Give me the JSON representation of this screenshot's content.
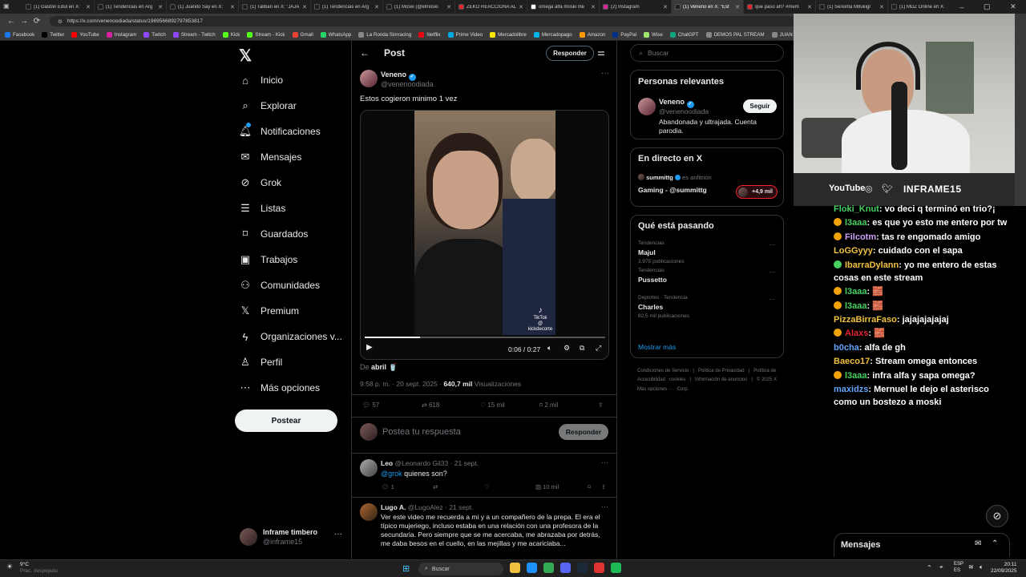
{
  "browser": {
    "tabs": [
      {
        "label": "(1) Gastón Edul en X:",
        "color": "#1d1d1d"
      },
      {
        "label": "(1) Tendencias en Arg",
        "color": "#1d1d1d"
      },
      {
        "label": "(1) Juanito Say en X:",
        "color": "#1d1d1d"
      },
      {
        "label": "(1) Taliban en X: \"JAJA",
        "color": "#1d1d1d"
      },
      {
        "label": "(1) Tendencias en Arg",
        "color": "#1d1d1d"
      },
      {
        "label": "(1) Moski (@elmoski",
        "color": "#1d1d1d"
      },
      {
        "label": "ZEKO REACCIONA AL",
        "color": "#e0252f"
      },
      {
        "label": "omega alfa moski me",
        "color": "#ffffff"
      },
      {
        "label": "(2) Instagram",
        "color": "#d6249f"
      },
      {
        "label": "(1) Veneno en X: \"Est",
        "color": "#1d1d1d",
        "active": true
      },
      {
        "label": "que paso ah? #mem",
        "color": "#e0252f"
      },
      {
        "label": "(1) Señorita M8ukigr",
        "color": "#1d1d1d"
      },
      {
        "label": "(1) MDZ Online en X:",
        "color": "#1d1d1d"
      }
    ],
    "new_tab": "+",
    "url": "https://x.com/venenoodiada/status/1969566892797853817",
    "bookmarks": [
      {
        "label": "Facebook",
        "color": "#1877f2"
      },
      {
        "label": "Twitter",
        "color": "#000000"
      },
      {
        "label": "YouTube",
        "color": "#ff0000"
      },
      {
        "label": "Instagram",
        "color": "#d6249f"
      },
      {
        "label": "Twitch",
        "color": "#9146ff"
      },
      {
        "label": "Stream - Twitch",
        "color": "#9146ff"
      },
      {
        "label": "Kick",
        "color": "#53fc18"
      },
      {
        "label": "Stream - Kick",
        "color": "#53fc18"
      },
      {
        "label": "Gmail",
        "color": "#ea4335"
      },
      {
        "label": "WhatsApp",
        "color": "#25d366"
      },
      {
        "label": "La Ronda Simracing",
        "color": "#888888"
      },
      {
        "label": "Netflix",
        "color": "#e50914"
      },
      {
        "label": "Prime Video",
        "color": "#00a8e1"
      },
      {
        "label": "Mercadolibre",
        "color": "#ffe600"
      },
      {
        "label": "Mercadopago",
        "color": "#00b1ea"
      },
      {
        "label": "Amazon",
        "color": "#ff9900"
      },
      {
        "label": "PayPal",
        "color": "#003087"
      },
      {
        "label": "Wise",
        "color": "#9fe870"
      },
      {
        "label": "ChatGPT",
        "color": "#10a37f"
      },
      {
        "label": "DEMOS PAL STREAM",
        "color": "#888888"
      },
      {
        "label": "JUAN TUR",
        "color": "#888888"
      }
    ]
  },
  "nav": {
    "logo": "𝕏",
    "items": [
      {
        "label": "Inicio",
        "icon": "home-icon"
      },
      {
        "label": "Explorar",
        "icon": "search-icon"
      },
      {
        "label": "Notificaciones",
        "icon": "bell-icon"
      },
      {
        "label": "Mensajes",
        "icon": "mail-icon"
      },
      {
        "label": "Grok",
        "icon": "grok-icon"
      },
      {
        "label": "Listas",
        "icon": "list-icon"
      },
      {
        "label": "Guardados",
        "icon": "bookmark-icon"
      },
      {
        "label": "Trabajos",
        "icon": "briefcase-icon"
      },
      {
        "label": "Comunidades",
        "icon": "people-icon"
      },
      {
        "label": "Premium",
        "icon": "x-icon"
      },
      {
        "label": "Organizaciones v...",
        "icon": "lightning-icon"
      },
      {
        "label": "Perfil",
        "icon": "person-icon"
      },
      {
        "label": "Más opciones",
        "icon": "more-icon"
      }
    ],
    "post_label": "Postear",
    "account_name": "Inframe timbero",
    "account_handle": "@inframe15"
  },
  "post": {
    "header_title": "Post",
    "reply_button": "Responder",
    "author_name": "Veneno",
    "author_handle": "@venenoodiada",
    "text": "Estos cogieron minimo 1 vez",
    "video_time": "0:06 / 0:27",
    "video_progress": 0.23,
    "watermark_line1": "TikTok",
    "watermark_line2": "@ kickdecorte",
    "from_prefix": "De",
    "from_name": "abril",
    "timestamp": "9:58 p. m. · 20 sept. 2025 ·",
    "views_count": "640,7 mil",
    "views_label": "Visualizaciones",
    "replies": "57",
    "reposts": "618",
    "likes": "15 mil",
    "bookmarks": "2 mil",
    "compose_placeholder": "Postea tu respuesta",
    "compose_button": "Responder"
  },
  "replies": [
    {
      "name": "Leo",
      "handle": "@Leonardo Gil33 · 21 sept.",
      "mention": "@grok",
      "text": "quienes son?",
      "replies": "1",
      "views": "10 mil"
    },
    {
      "name": "Lugo A.",
      "handle": "@LugoAlez · 21 sept.",
      "text": "Ver este video me recuerda a mi y a un compañero de la prepa. El era el típico mujeriego, incluso estaba en una relación con una profesora de la secundaria. Pero siempre que se me acercaba, me abrazaba por detrás, me daba besos en el cuello, en las mejillas y me acariciaba..."
    }
  ],
  "right": {
    "search_placeholder": "Buscar",
    "relevant_title": "Personas relevantes",
    "relevant_name": "Veneno",
    "relevant_handle": "@venenoodiada",
    "follow_label": "Seguir",
    "relevant_bio": "Abandonada y ultrajada. Cuenta parodia.",
    "live_title": "En directo en X",
    "live_host": "summittg",
    "live_host_role": "es anfitrión",
    "live_title_text": "Gaming - @summittg",
    "live_count": "+4,9 mil",
    "trending_title": "Qué está pasando",
    "trends": [
      {
        "context": "Tendencias",
        "name": "Majul",
        "count": "3.975 publicaciones"
      },
      {
        "context": "Tendencias",
        "name": "Pussetto",
        "count": ""
      },
      {
        "context": "Deportes · Tendencia",
        "name": "Charles",
        "count": "82,5 mil publicaciones"
      }
    ],
    "show_more": "Mostrar más",
    "footer": [
      "Condiciones de Servicio",
      "|",
      "Política de Privacidad",
      "|",
      "Política de cookies",
      "|",
      "Accesibilidad",
      "Información de anuncios",
      "|",
      "Más opciones ···",
      "© 2025 X Corp."
    ]
  },
  "stream": {
    "socials": [
      "YouTube",
      "INFRAME15"
    ],
    "messages": [
      {
        "user": "Floki_Knut",
        "color": "#46d160",
        "badge": "",
        "text": ": vo deci q terminó en trio?¡"
      },
      {
        "user": "l3aaa",
        "color": "#46d160",
        "badge": "#f0a30a",
        "text": ": es que yo esto me entero por tw"
      },
      {
        "user": "Filcotm",
        "color": "#cfa0ff",
        "badge": "#f0a30a",
        "text": ": tas re engomado amigo"
      },
      {
        "user": "LoGGyyy",
        "color": "#f0c040",
        "badge": "",
        "text": ": cuidado con el sapa"
      },
      {
        "user": "IbarraDylann",
        "color": "#f0c040",
        "badge": "#46d160",
        "text": ": yo me entero de estas cosas en este stream"
      },
      {
        "user": "l3aaa",
        "color": "#46d160",
        "badge": "#f0a30a",
        "text": ": 🧱"
      },
      {
        "user": "l3aaa",
        "color": "#46d160",
        "badge": "#f0a30a",
        "text": ": 🧱"
      },
      {
        "user": "PizzaBirraFaso",
        "color": "#f0c040",
        "badge": "",
        "text": ": jajajajajajaj"
      },
      {
        "user": "Alaxs",
        "color": "#e0252f",
        "badge": "#f0a30a",
        "text": ": 🧱"
      },
      {
        "user": "b0cha",
        "color": "#63a4ff",
        "badge": "",
        "text": ": alfa de gh"
      },
      {
        "user": "Baeco17",
        "color": "#f0c040",
        "badge": "",
        "text": ": Stream omega entonces"
      },
      {
        "user": "l3aaa",
        "color": "#46d160",
        "badge": "#f0a30a",
        "text": ": infra alfa y sapa omega?"
      },
      {
        "user": "maxidzs",
        "color": "#63a4ff",
        "badge": "",
        "text": ": Mernuel le dejo el asterisco como un bostezo a moski"
      }
    ],
    "dm_label": "Mensajes"
  },
  "taskbar": {
    "weather_temp": "9°C",
    "weather_desc": "Prac. despejado",
    "search_label": "Buscar",
    "lang": "ESP\nES",
    "time": "20:11",
    "date": "22/09/2025"
  }
}
